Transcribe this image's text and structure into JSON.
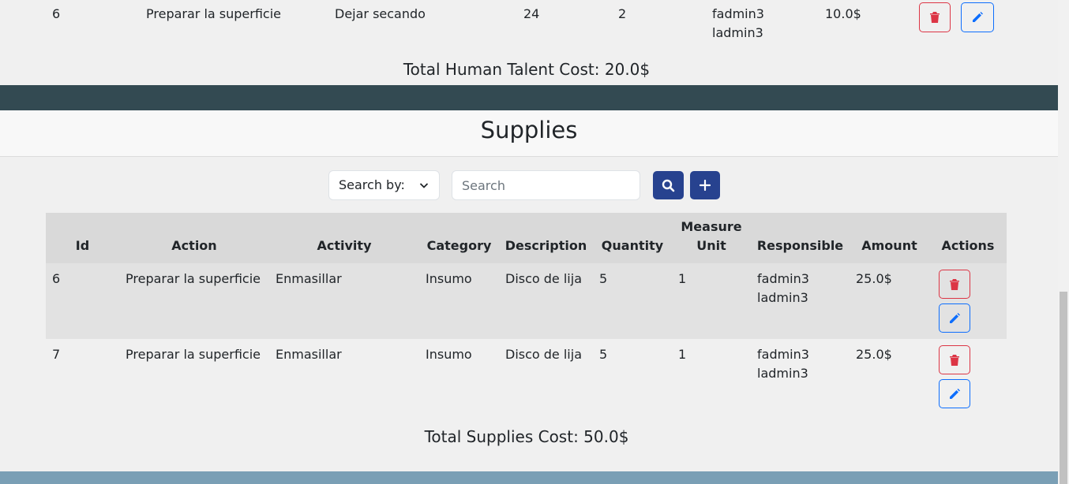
{
  "human_talent": {
    "row": {
      "id": "6",
      "action": "Preparar la superficie",
      "activity": "Dejar secando",
      "hours": "24",
      "people": "2",
      "responsible_1": "fadmin3",
      "responsible_2": "ladmin3",
      "amount": "10.0$"
    },
    "total": "Total Human Talent Cost: 20.0$"
  },
  "supplies": {
    "title": "Supplies",
    "search_by_label": "Search by:",
    "search_placeholder": "Search",
    "columns": {
      "id": "Id",
      "action": "Action",
      "activity": "Activity",
      "category": "Category",
      "description": "Description",
      "quantity": "Quantity",
      "measure_unit_1": "Measure",
      "measure_unit_2": "Unit",
      "responsible": "Responsible",
      "amount": "Amount",
      "actions": "Actions"
    },
    "rows": [
      {
        "id": "6",
        "action": "Preparar la superficie",
        "activity": "Enmasillar",
        "category": "Insumo",
        "description": "Disco de lija",
        "quantity": "5",
        "measure_unit": "1",
        "responsible_1": "fadmin3",
        "responsible_2": "ladmin3",
        "amount": "25.0$"
      },
      {
        "id": "7",
        "action": "Preparar la superficie",
        "activity": "Enmasillar",
        "category": "Insumo",
        "description": "Disco de lija",
        "quantity": "5",
        "measure_unit": "1",
        "responsible_1": "fadmin3",
        "responsible_2": "ladmin3",
        "amount": "25.0$"
      }
    ],
    "total": "Total Supplies Cost: 50.0$"
  },
  "icons": {
    "chevron": "chevron-down-icon",
    "search": "search-icon",
    "add": "plus-icon",
    "delete": "trash-icon",
    "edit": "pencil-icon"
  },
  "colors": {
    "primary_dark": "#27428f",
    "danger": "#dc3545",
    "edit_blue": "#0d6efd",
    "band_dark": "#334a52",
    "band_footer": "#7a9fb5"
  }
}
